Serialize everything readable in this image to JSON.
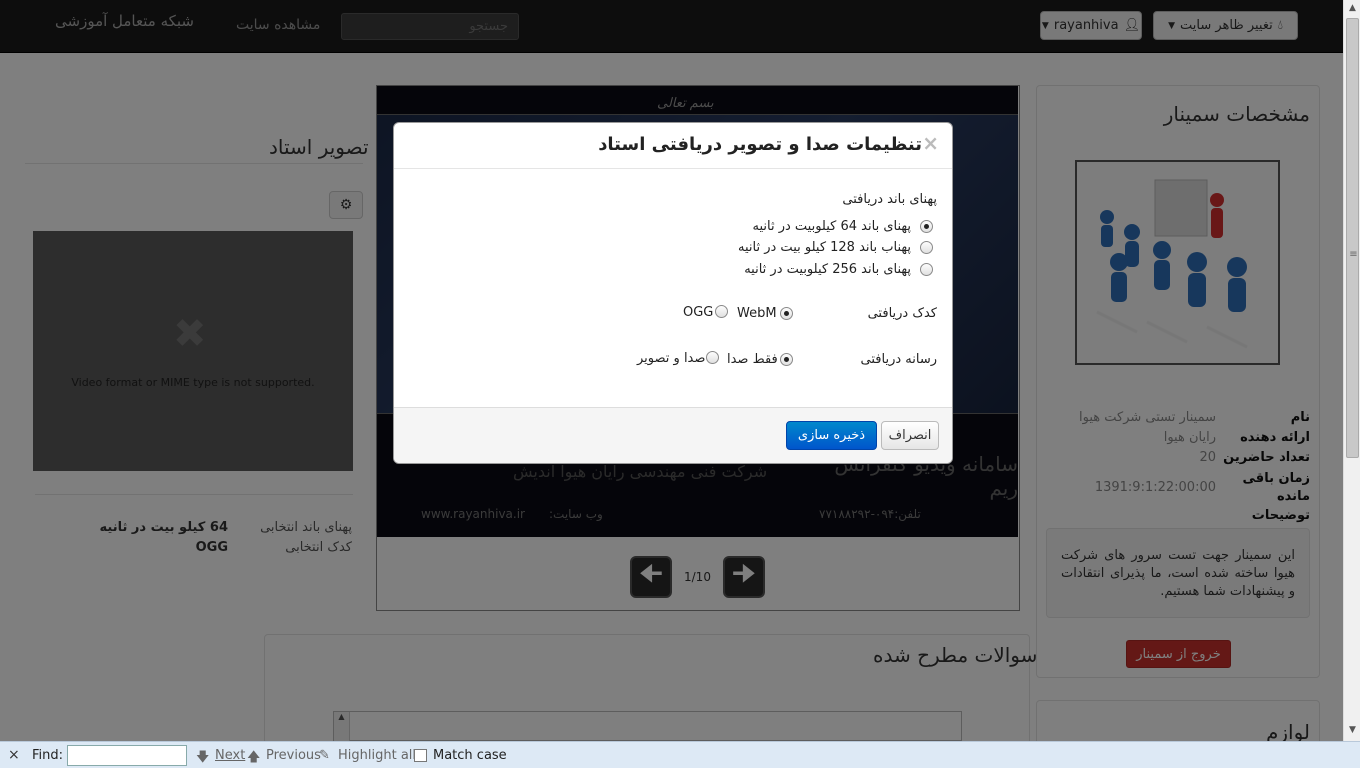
{
  "navbar": {
    "theme_button": "تغییر ظاهر سایت",
    "user_button": "rayanhiva",
    "search_placeholder": "جستجو",
    "view_site": "مشاهده سایت",
    "brand": "شبکه متعامل آموزشی"
  },
  "seminar": {
    "title": "مشخصات سمینار",
    "fields": [
      {
        "key": "نام",
        "value": "سمینار تستی شرکت هیوا"
      },
      {
        "key": "ارائه دهنده",
        "value": "رایان هیوا"
      },
      {
        "key": "تعداد حاضرین",
        "value": "20"
      },
      {
        "key": "زمان باقی مانده",
        "value": "1391:9:1:22:00:00"
      },
      {
        "key": "توضیحات",
        "value": ""
      }
    ],
    "description": "این سمینار جهت تست سرور های شرکت هیوا ساخته شده است، ما پذیرای انتقادات و پیشنهادات شما هستیم.",
    "exit_button": "خروج از سمینار",
    "tools_title": "لوازم"
  },
  "slides": {
    "counter": "1/10",
    "website": "www.rayanhiva.ir",
    "website_label": "وب سایت:",
    "phone": "تلفن:۰۹۴-۷۷۱۸۸۲۹۲",
    "company": "شرکت فنی مهندسی رایان هیوا اندیش",
    "product": "سامانه ویدیو کنفرانس ریم",
    "header_text": "بسم تعالی"
  },
  "teacher": {
    "title": "تصویر استاد",
    "video_error": "Video format or MIME type is not supported.",
    "bandwidth_label": "پهنای باند انتخابی",
    "bandwidth_value": "64 کیلو بیت در ثانیه",
    "codec_label": "کدک انتخابی",
    "codec_value": "OGG"
  },
  "questions": {
    "title": "سوالات مطرح شده"
  },
  "modal": {
    "title": "تنظیمات صدا و تصویر دریافتی استاد",
    "close": "×",
    "bandwidth_label": "پهنای باند دریافتی",
    "bandwidth_options": [
      {
        "label": "پهنای باند 64 کیلوبیت در ثانیه",
        "selected": true
      },
      {
        "label": "پهناب باند 128 کیلو بیت در ثانیه",
        "selected": false
      },
      {
        "label": "پهنای باند 256 کیلوبیت در ثانیه",
        "selected": false
      }
    ],
    "codec_label": "کدک دریافتی",
    "codec_options": [
      {
        "label": "WebM",
        "selected": true
      },
      {
        "label": "OGG",
        "selected": false
      }
    ],
    "media_label": "رسانه دریافتی",
    "media_options": [
      {
        "label": "فقط صدا",
        "selected": true
      },
      {
        "label": "صدا و تصویر",
        "selected": false
      }
    ],
    "save_button": "ذخیره سازی",
    "cancel_button": "انصراف"
  },
  "findbar": {
    "close": "×",
    "label": "Find:",
    "next": "Next",
    "previous": "Previous",
    "highlight_all": "Highlight all",
    "match_case": "Match case"
  }
}
